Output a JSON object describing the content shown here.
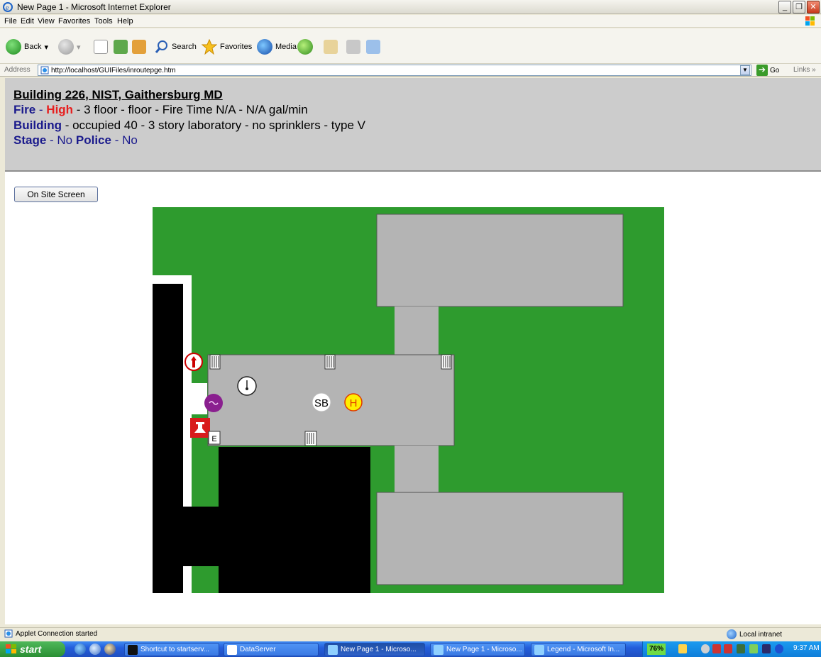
{
  "window": {
    "title": "New Page 1 - Microsoft Internet Explorer",
    "controls": [
      "_",
      "❐",
      "✕"
    ]
  },
  "menu": [
    "File",
    "Edit",
    "View",
    "Favorites",
    "Tools",
    "Help"
  ],
  "toolbar": {
    "back": "Back",
    "search": "Search",
    "favorites": "Favorites",
    "media": "Media"
  },
  "address": {
    "label": "Address",
    "url": "http://localhost/GUIFiles/inroutepge.htm",
    "go": "Go",
    "links": "Links"
  },
  "header": {
    "line1": "Building 226, NIST, Gaithersburg MD",
    "fire_label": "Fire",
    "fire_level": "High",
    "fire_details": " - 3 floor - floor - Fire Time N/A - N/A gal/min",
    "building_label": "Building",
    "building_details": " - occupied 40 - 3 story laboratory - no sprinklers - type V",
    "stage_label": "Stage",
    "stage_value": "No",
    "police_label": "Police",
    "police_value": "No"
  },
  "onsite_button": "On Site Screen",
  "map": {
    "markers": {
      "sb": "SB",
      "hydrant": "H",
      "entrance": "E"
    },
    "colors": {
      "grass": "#2e9b2e",
      "building": "#b4b4b4",
      "road": "#000000",
      "sidewalk": "#ffffff"
    }
  },
  "status": {
    "text": "Applet Connection started",
    "zone": "Local intranet"
  },
  "taskbar": {
    "start": "start",
    "tasks": [
      "Shortcut to startserv...",
      "DataServer",
      "New Page 1 - Microso...",
      "New Page 1 - Microso...",
      "Legend - Microsoft In..."
    ],
    "battery": "76%",
    "clock": "9:37 AM"
  }
}
